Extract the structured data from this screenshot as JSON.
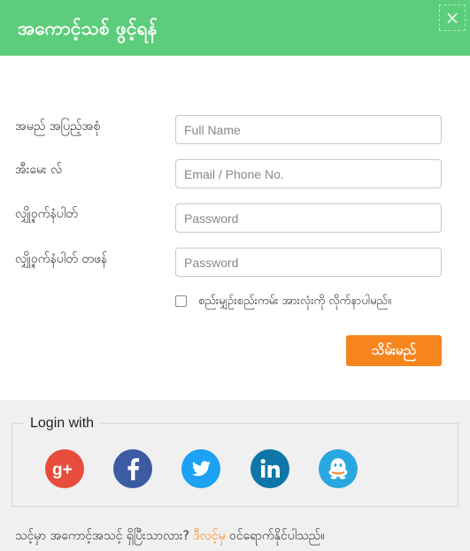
{
  "header": {
    "title": "အကောင့်သစ် ဖွင့်ရန်",
    "close_label": "×"
  },
  "form": {
    "fields": [
      {
        "label": "အမည် အပြည့်အစုံ",
        "placeholder": "Full Name"
      },
      {
        "label": "အီးမေး လ်",
        "placeholder": "Email / Phone No."
      },
      {
        "label": "လျှို့ဝှက်နံပါတ်",
        "placeholder": "Password"
      },
      {
        "label": "လျှို့ဝှက်နံပါတ် တဖန်",
        "placeholder": "Password"
      }
    ],
    "agree_label": "စည်းမျှဥ်းစည်းကမ်း အားလုံးကို လိုက်နာပါမည်။",
    "agree_checked": false,
    "submit_label": "သိမ်းမည်"
  },
  "social": {
    "legend": "Login with",
    "providers": [
      {
        "name": "Google+",
        "icon": "google-plus-icon",
        "color": "#e74c3c"
      },
      {
        "name": "Facebook",
        "icon": "facebook-icon",
        "color": "#3b5ba3"
      },
      {
        "name": "Twitter",
        "icon": "twitter-icon",
        "color": "#1da1f2"
      },
      {
        "name": "LinkedIn",
        "icon": "linkedin-icon",
        "color": "#0e76a8"
      },
      {
        "name": "QQ",
        "icon": "qq-icon",
        "color": "#29a7e1"
      }
    ]
  },
  "footer": {
    "text": "သင့်မှာ အကောင့်အသင့် ရှိပြီးသာလား?",
    "link": "ဒီလင့်မှ",
    "suffix": "ဝင်ရောက်နိုင်ပါသည်။"
  },
  "colors": {
    "header": "#5ccd7a",
    "accent": "#f7851d"
  }
}
